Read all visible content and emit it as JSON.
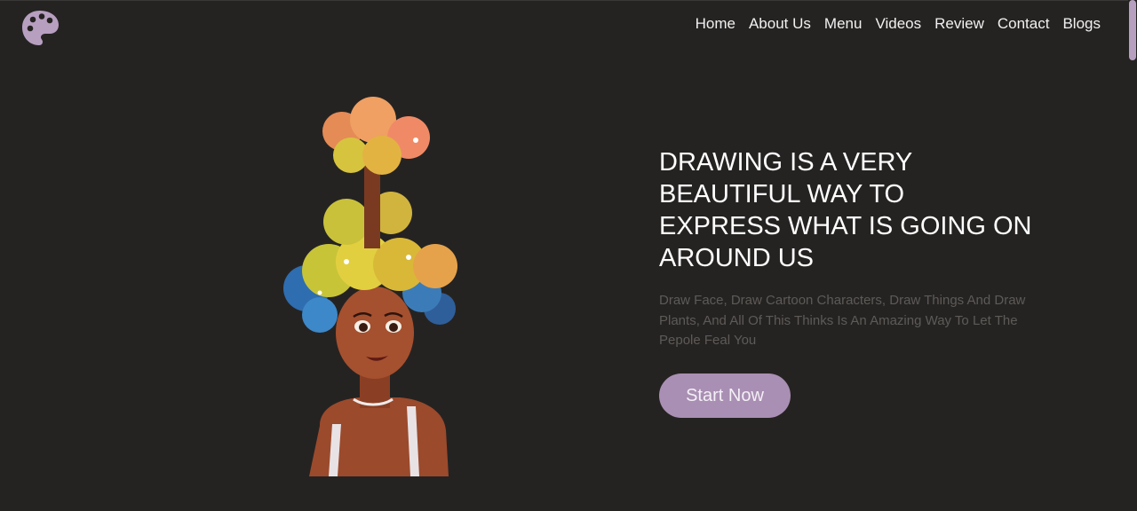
{
  "brand": {
    "logo_icon": "palette-icon",
    "accent": "#a98fb3"
  },
  "nav": {
    "items": [
      {
        "label": "Home"
      },
      {
        "label": "About Us"
      },
      {
        "label": "Menu"
      },
      {
        "label": "Videos"
      },
      {
        "label": "Review"
      },
      {
        "label": "Contact"
      },
      {
        "label": "Blogs"
      }
    ]
  },
  "hero": {
    "image_icon": "girl-with-flower-hair-illustration",
    "title": "DRAWING IS A VERY BEAUTIFUL WAY TO EXPRESS WHAT IS GOING ON AROUND US",
    "subtitle": "Draw Face, Draw Cartoon Characters, Draw Things And Draw Plants, And All Of This Thinks Is An Amazing Way To Let The Pepole Feal You",
    "button_label": "Start Now"
  },
  "colors": {
    "background": "#252322",
    "text": "#ffffff",
    "muted": "#5d5a57"
  }
}
